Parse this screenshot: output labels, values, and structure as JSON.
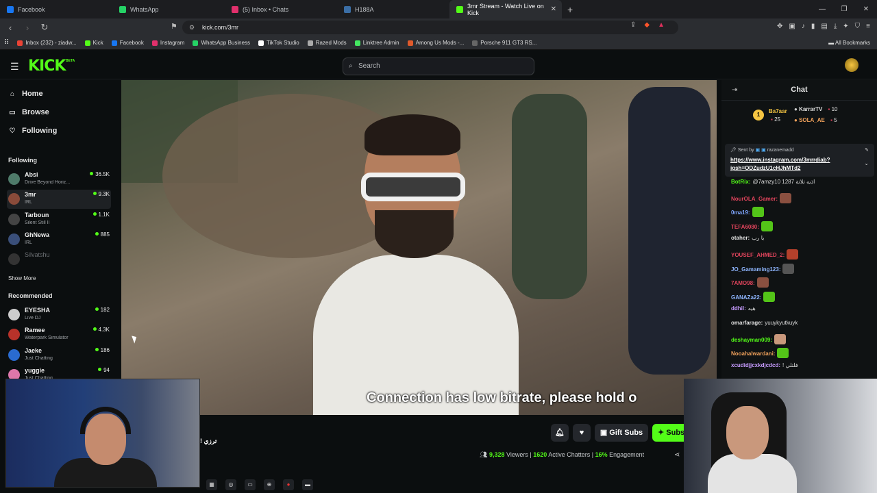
{
  "browser": {
    "tabs": [
      {
        "label": "Facebook",
        "color": "#1877f2"
      },
      {
        "label": "WhatsApp",
        "color": "#25d366"
      },
      {
        "label": "(5) Inbox • Chats",
        "color": "#e1306c"
      },
      {
        "label": "H188A",
        "color": "#3b6ea5"
      },
      {
        "label": "3mr Stream - Watch Live on Kick",
        "color": "#53fc18"
      }
    ],
    "url": "kick.com/3mr",
    "bookmarks": [
      {
        "label": "Inbox (232) - ziadw...",
        "color": "#ea4335"
      },
      {
        "label": "Kick",
        "color": "#53fc18"
      },
      {
        "label": "Facebook",
        "color": "#1877f2"
      },
      {
        "label": "Instagram",
        "color": "#e1306c"
      },
      {
        "label": "WhatsApp Business",
        "color": "#25d366"
      },
      {
        "label": "TikTok Studio",
        "color": "#ffffff"
      },
      {
        "label": "Razed Mods",
        "color": "#aaaaaa"
      },
      {
        "label": "Linktree Admin",
        "color": "#43e660"
      },
      {
        "label": "Among Us Mods -...",
        "color": "#e05a2b"
      },
      {
        "label": "Porsche 911 GT3 RS...",
        "color": "#666666"
      }
    ],
    "all_bookmarks": "All Bookmarks"
  },
  "kick": {
    "logo": "KICK",
    "beta": "BETA",
    "search_placeholder": "Search",
    "accent": "#53fc18"
  },
  "sidebar": {
    "nav": [
      {
        "label": "Home",
        "icon": "⌂"
      },
      {
        "label": "Browse",
        "icon": "▭"
      },
      {
        "label": "Following",
        "icon": "♡"
      }
    ],
    "following_title": "Following",
    "following": [
      {
        "name": "Absi",
        "sub": "Drive Beyond Horiz...",
        "viewers": "36.5K",
        "color": "#4f7b6a"
      },
      {
        "name": "3mr",
        "sub": "IRL",
        "viewers": "9.3K",
        "color": "#8a4b3a"
      },
      {
        "name": "Tarboun",
        "sub": "Silent Still II",
        "viewers": "1.1K",
        "color": "#444"
      },
      {
        "name": "GhNewa",
        "sub": "IRL",
        "viewers": "885",
        "color": "#3a4f7a"
      },
      {
        "name": "Silvatshu",
        "sub": "",
        "viewers": "",
        "color": "#333"
      }
    ],
    "show_more": "Show More",
    "recommended_title": "Recommended",
    "recommended": [
      {
        "name": "EYESHA",
        "sub": "Live DJ",
        "viewers": "182",
        "color": "#ccc"
      },
      {
        "name": "Ramee",
        "sub": "Waterpark Simulator",
        "viewers": "4.3K",
        "color": "#b8322a"
      },
      {
        "name": "Jaeke",
        "sub": "Just Chatting",
        "viewers": "186",
        "color": "#2a6bd0"
      },
      {
        "name": "yuggie",
        "sub": "Just Chatting",
        "viewers": "94",
        "color": "#d7a"
      }
    ]
  },
  "player": {
    "caption": "Connection has low bitrate, please hold o"
  },
  "below_player": {
    "gift_subs": "Gift Subs",
    "subscribe": "Subs",
    "arabic_line": "! ترزي",
    "viewers_value": "9,328",
    "viewers_label": "Viewers",
    "chatters_value": "1620",
    "chatters_label": "Active Chatters",
    "engagement_value": "16%",
    "engagement_label": "Engagement"
  },
  "chat": {
    "title": "Chat",
    "leaders": [
      {
        "name": "Ba7aar",
        "count": "25"
      },
      {
        "name": "KarrarTV",
        "count": "10"
      },
      {
        "name": "SOLA_AE",
        "count": "5"
      }
    ],
    "pinned_sent_by": "Sent by",
    "pinned_user": "razanemadd",
    "pinned_link": "https://www.instagram.com/3mrrdiab?igsh=ODZudzU1cHJhMTd2",
    "messages": [
      {
        "user": "BotRix:",
        "text": "@7amzy10 1287 اذيه تلاتة",
        "color": "#53fc18"
      },
      {
        "user": "NourOLA_Gamer:",
        "text": "",
        "color": "#e0445c",
        "emote": "#8a5040"
      },
      {
        "user": "0ma19:",
        "text": "",
        "color": "#7fa6ff",
        "emote": "#53c418"
      },
      {
        "user": "TEFA6080:",
        "text": "",
        "color": "#e0445c",
        "emote": "#53c418"
      },
      {
        "user": "otaher:",
        "text": "يا رب",
        "color": "#e0e0e0"
      },
      {
        "user": "YOUSEF_AHMED_2:",
        "text": "",
        "color": "#e0445c",
        "emote": "#b3402b"
      },
      {
        "user": "JO_Gamaming123:",
        "text": "",
        "color": "#8fb6ff",
        "emote": "#555"
      },
      {
        "user": "7AMO98:",
        "text": "",
        "color": "#e0445c",
        "emote": "#8a5040"
      },
      {
        "user": "GANAZa22:",
        "text": "",
        "color": "#8fb6ff",
        "emote": "#53c418"
      },
      {
        "user": "ddhil:",
        "text": "هيه",
        "color": "#c79cff"
      },
      {
        "user": "omarfarage:",
        "text": "yuuykyutkuyk",
        "color": "#e0e0e0"
      },
      {
        "user": "deshayman009:",
        "text": "",
        "color": "#53fc18",
        "emote": "#c9987c"
      },
      {
        "user": "Nooahalwardani:",
        "text": "",
        "color": "#f0a15b",
        "emote": "#53c418"
      },
      {
        "user": "xcudidjjcxkdjcdcd:",
        "text": "! فلتلي",
        "color": "#c79cff"
      }
    ]
  }
}
